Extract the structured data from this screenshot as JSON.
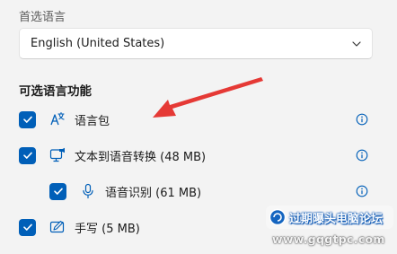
{
  "language_section": {
    "label": "首选语言",
    "selected_value": "English (United States)"
  },
  "optional_features": {
    "heading": "可选语言功能",
    "items": [
      {
        "label": "语言包",
        "icon": "language-pack-icon",
        "checked": true
      },
      {
        "label": "文本到语音转换 (48 MB)",
        "icon": "text-to-speech-icon",
        "checked": true
      },
      {
        "label": "语音识别 (61 MB)",
        "icon": "microphone-icon",
        "checked": true
      },
      {
        "label": "手写 (5 MB)",
        "icon": "handwriting-icon",
        "checked": true
      }
    ]
  },
  "watermark": {
    "site_name": "过期曝头电脑论坛",
    "url": "www.gqgtpc.com"
  },
  "colors": {
    "accent": "#005fb8",
    "arrow": "#e53935",
    "background": "#f3f3f3"
  }
}
